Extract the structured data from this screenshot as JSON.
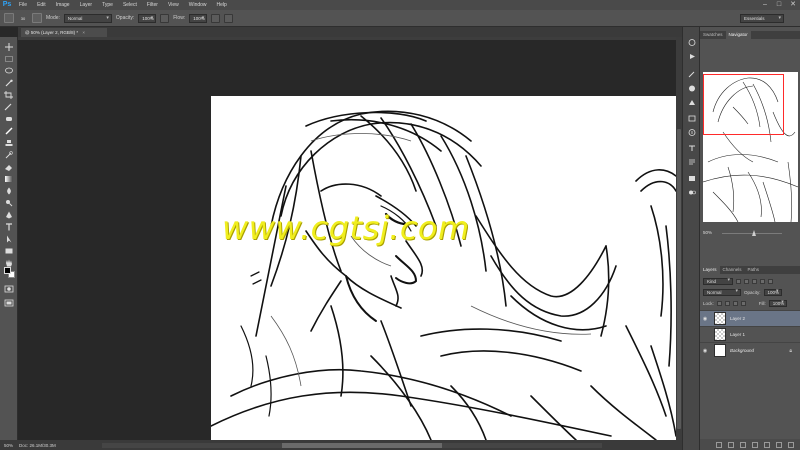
{
  "app": {
    "logo": "Ps",
    "menu": [
      "File",
      "Edit",
      "Image",
      "Layer",
      "Type",
      "Select",
      "Filter",
      "View",
      "Window",
      "Help"
    ],
    "window_controls": [
      "–",
      "□",
      "✕"
    ]
  },
  "options_bar": {
    "brush_size": "30",
    "mode_label": "Mode:",
    "mode_value": "Normal",
    "opacity_label": "Opacity:",
    "opacity_value": "100%",
    "flow_label": "Flow:",
    "flow_value": "100%",
    "workspace": "Essentials"
  },
  "document": {
    "tab_title": "@ 50% (Layer 2, RGB/8) *",
    "tab_close": "×"
  },
  "canvas": {
    "watermark": "www.cgtsj.com"
  },
  "status": {
    "zoom": "50%",
    "doc_size": "Doc: 26.1M/30.3M"
  },
  "navigator": {
    "tabs": [
      "Swatches",
      "Navigator"
    ],
    "active_tab": "Navigator",
    "zoom": "50%"
  },
  "layers_panel": {
    "tabs": [
      "Layers",
      "Channels",
      "Paths"
    ],
    "active_tab": "Layers",
    "kind_label": "Kind",
    "blend_mode": "Normal",
    "opacity_label": "Opacity:",
    "opacity_value": "100%",
    "lock_label": "Lock:",
    "fill_label": "Fill:",
    "fill_value": "100%",
    "layers": [
      {
        "name": "Layer 2",
        "selected": true,
        "visible": true
      },
      {
        "name": "Layer 1",
        "selected": false,
        "visible": false
      },
      {
        "name": "Background",
        "selected": false,
        "visible": true,
        "locked": true
      }
    ]
  },
  "colors": {
    "accent": "#2fa3f6",
    "selection": "#6a7587",
    "navigator_box": "#ff2a2a",
    "watermark": "#f0ee1e"
  }
}
